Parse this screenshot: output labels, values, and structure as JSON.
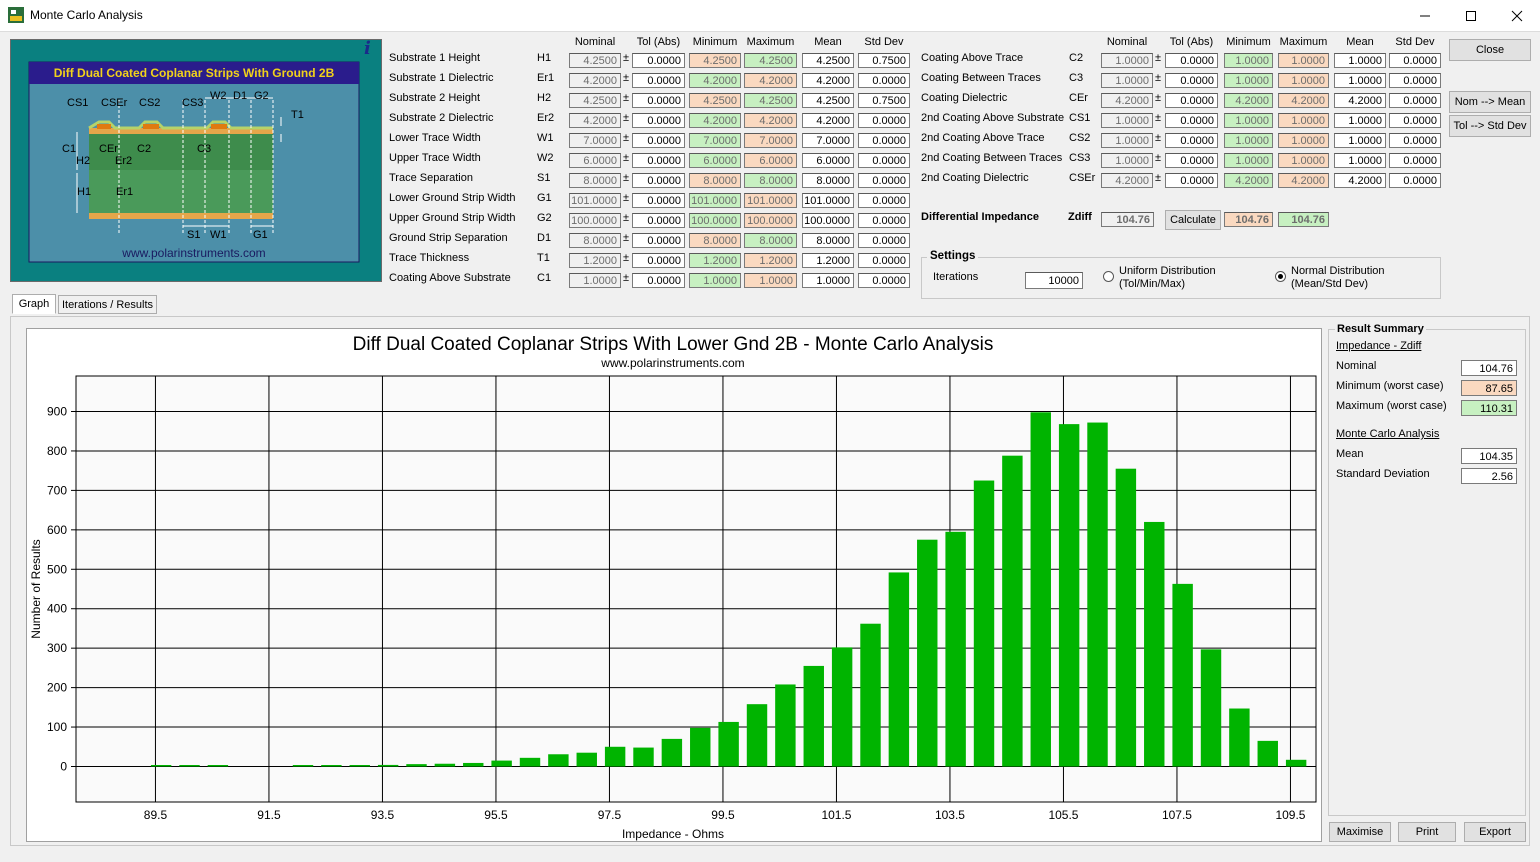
{
  "window": {
    "title": "Monte Carlo Analysis"
  },
  "diagram": {
    "title": "Diff Dual Coated Coplanar Strips With Ground 2B",
    "url": "www.polarinstruments.com",
    "labels": [
      "CS1",
      "CSEr",
      "CS2",
      "CS3",
      "W2",
      "D1",
      "G2",
      "T1",
      "C1",
      "CEr",
      "C2",
      "C3",
      "H2",
      "Er2",
      "H1",
      "Er1",
      "S1",
      "W1",
      "G1"
    ]
  },
  "columns": [
    "Nominal",
    "Tol (Abs)",
    "Minimum",
    "Maximum",
    "Mean",
    "Std Dev"
  ],
  "left_params": [
    {
      "label": "Substrate 1 Height",
      "sym": "H1",
      "nom": "4.2500",
      "tol": "0.0000",
      "min": "4.2500",
      "max": "4.2500",
      "mean": "4.2500",
      "std": "0.7500",
      "minc": "org",
      "maxc": "grn"
    },
    {
      "label": "Substrate 1 Dielectric",
      "sym": "Er1",
      "nom": "4.2000",
      "tol": "0.0000",
      "min": "4.2000",
      "max": "4.2000",
      "mean": "4.2000",
      "std": "0.0000",
      "minc": "grn",
      "maxc": "org"
    },
    {
      "label": "Substrate 2 Height",
      "sym": "H2",
      "nom": "4.2500",
      "tol": "0.0000",
      "min": "4.2500",
      "max": "4.2500",
      "mean": "4.2500",
      "std": "0.7500",
      "minc": "org",
      "maxc": "grn"
    },
    {
      "label": "Substrate 2 Dielectric",
      "sym": "Er2",
      "nom": "4.2000",
      "tol": "0.0000",
      "min": "4.2000",
      "max": "4.2000",
      "mean": "4.2000",
      "std": "0.0000",
      "minc": "grn",
      "maxc": "org"
    },
    {
      "label": "Lower Trace Width",
      "sym": "W1",
      "nom": "7.0000",
      "tol": "0.0000",
      "min": "7.0000",
      "max": "7.0000",
      "mean": "7.0000",
      "std": "0.0000",
      "minc": "grn",
      "maxc": "org"
    },
    {
      "label": "Upper Trace Width",
      "sym": "W2",
      "nom": "6.0000",
      "tol": "0.0000",
      "min": "6.0000",
      "max": "6.0000",
      "mean": "6.0000",
      "std": "0.0000",
      "minc": "grn",
      "maxc": "org"
    },
    {
      "label": "Trace Separation",
      "sym": "S1",
      "nom": "8.0000",
      "tol": "0.0000",
      "min": "8.0000",
      "max": "8.0000",
      "mean": "8.0000",
      "std": "0.0000",
      "minc": "org",
      "maxc": "grn"
    },
    {
      "label": "Lower Ground Strip Width",
      "sym": "G1",
      "nom": "101.0000",
      "tol": "0.0000",
      "min": "101.0000",
      "max": "101.0000",
      "mean": "101.0000",
      "std": "0.0000",
      "minc": "grn",
      "maxc": "org"
    },
    {
      "label": "Upper Ground Strip Width",
      "sym": "G2",
      "nom": "100.0000",
      "tol": "0.0000",
      "min": "100.0000",
      "max": "100.0000",
      "mean": "100.0000",
      "std": "0.0000",
      "minc": "grn",
      "maxc": "org"
    },
    {
      "label": "Ground Strip Separation",
      "sym": "D1",
      "nom": "8.0000",
      "tol": "0.0000",
      "min": "8.0000",
      "max": "8.0000",
      "mean": "8.0000",
      "std": "0.0000",
      "minc": "org",
      "maxc": "grn"
    },
    {
      "label": "Trace Thickness",
      "sym": "T1",
      "nom": "1.2000",
      "tol": "0.0000",
      "min": "1.2000",
      "max": "1.2000",
      "mean": "1.2000",
      "std": "0.0000",
      "minc": "grn",
      "maxc": "org"
    },
    {
      "label": "Coating Above Substrate",
      "sym": "C1",
      "nom": "1.0000",
      "tol": "0.0000",
      "min": "1.0000",
      "max": "1.0000",
      "mean": "1.0000",
      "std": "0.0000",
      "minc": "grn",
      "maxc": "org"
    }
  ],
  "right_params": [
    {
      "label": "Coating Above Trace",
      "sym": "C2",
      "nom": "1.0000",
      "tol": "0.0000",
      "min": "1.0000",
      "max": "1.0000",
      "mean": "1.0000",
      "std": "0.0000",
      "minc": "grn",
      "maxc": "org"
    },
    {
      "label": "Coating Between Traces",
      "sym": "C3",
      "nom": "1.0000",
      "tol": "0.0000",
      "min": "1.0000",
      "max": "1.0000",
      "mean": "1.0000",
      "std": "0.0000",
      "minc": "grn",
      "maxc": "org"
    },
    {
      "label": "Coating Dielectric",
      "sym": "CEr",
      "nom": "4.2000",
      "tol": "0.0000",
      "min": "4.2000",
      "max": "4.2000",
      "mean": "4.2000",
      "std": "0.0000",
      "minc": "grn",
      "maxc": "org"
    },
    {
      "label": "2nd Coating Above Substrate",
      "sym": "CS1",
      "nom": "1.0000",
      "tol": "0.0000",
      "min": "1.0000",
      "max": "1.0000",
      "mean": "1.0000",
      "std": "0.0000",
      "minc": "grn",
      "maxc": "org"
    },
    {
      "label": "2nd Coating Above Trace",
      "sym": "CS2",
      "nom": "1.0000",
      "tol": "0.0000",
      "min": "1.0000",
      "max": "1.0000",
      "mean": "1.0000",
      "std": "0.0000",
      "minc": "grn",
      "maxc": "org"
    },
    {
      "label": "2nd Coating Between Traces",
      "sym": "CS3",
      "nom": "1.0000",
      "tol": "0.0000",
      "min": "1.0000",
      "max": "1.0000",
      "mean": "1.0000",
      "std": "0.0000",
      "minc": "grn",
      "maxc": "org"
    },
    {
      "label": "2nd Coating Dielectric",
      "sym": "CSEr",
      "nom": "4.2000",
      "tol": "0.0000",
      "min": "4.2000",
      "max": "4.2000",
      "mean": "4.2000",
      "std": "0.0000",
      "minc": "grn",
      "maxc": "org"
    }
  ],
  "impedance": {
    "label": "Differential Impedance",
    "sym": "Zdiff",
    "value": "104.76",
    "calc_label": "Calculate",
    "min": "104.76",
    "max": "104.76"
  },
  "buttons": {
    "close": "Close",
    "nom_mean": "Nom --> Mean",
    "tol_std": "Tol --> Std Dev",
    "maximise": "Maximise",
    "print": "Print",
    "export": "Export"
  },
  "settings": {
    "title": "Settings",
    "iterations_label": "Iterations",
    "iterations": "10000",
    "uniform_l1": "Uniform Distribution",
    "uniform_l2": "(Tol/Min/Max)",
    "normal_l1": "Normal Distribution",
    "normal_l2": "(Mean/Std Dev)",
    "selected": "normal"
  },
  "tabs": [
    "Graph",
    "Iterations / Results"
  ],
  "summary": {
    "title": "Result Summary",
    "section1": "Impedance - Zdiff",
    "nominal_label": "Nominal",
    "nominal": "104.76",
    "min_label": "Minimum (worst case)",
    "min": "87.65",
    "max_label": "Maximum (worst case)",
    "max": "110.31",
    "section2": "Monte Carlo Analysis",
    "mean_label": "Mean",
    "mean": "104.35",
    "std_label": "Standard Deviation",
    "std": "2.56"
  },
  "colors": {
    "bar": "#00b400",
    "min_box": "#fad9c0",
    "max_box": "#c7f0c1",
    "diagram_bg": "#0a8080",
    "diagram_title_bg": "#2a1c8c",
    "diagram_title_fg": "#f2d21a"
  },
  "chart_data": {
    "type": "bar",
    "title": "Diff Dual Coated Coplanar Strips With Lower Gnd 2B - Monte Carlo Analysis",
    "subtitle": "www.polarinstruments.com",
    "xlabel": "Impedance - Ohms",
    "ylabel": "Number of Results",
    "xlim": [
      88.1,
      109.95
    ],
    "ylim": [
      -90,
      990
    ],
    "xticks": [
      89.5,
      91.5,
      93.5,
      95.5,
      97.5,
      99.5,
      101.5,
      103.5,
      105.5,
      107.5,
      109.5
    ],
    "xtick_labels": [
      "89.5",
      "91.5",
      "93.5",
      "95.5",
      "97.5",
      "99.5",
      "101.5",
      "103.5",
      "105.5",
      "107.5",
      "109.5"
    ],
    "yticks": [
      0,
      100,
      200,
      300,
      400,
      500,
      600,
      700,
      800,
      900
    ],
    "grid": true,
    "x": [
      89.6,
      90.1,
      90.6,
      92.1,
      92.6,
      93.1,
      93.6,
      94.1,
      94.6,
      95.1,
      95.6,
      96.1,
      96.6,
      97.1,
      97.6,
      98.1,
      98.6,
      99.1,
      99.6,
      100.1,
      100.6,
      101.1,
      101.6,
      102.1,
      102.6,
      103.1,
      103.6,
      104.1,
      104.6,
      105.1,
      105.6,
      106.1,
      106.6,
      107.1,
      107.6,
      108.1,
      108.6,
      109.1,
      109.6
    ],
    "values": [
      2,
      1,
      1,
      3,
      3,
      2,
      4,
      6,
      7,
      9,
      15,
      22,
      31,
      35,
      50,
      48,
      70,
      98,
      113,
      158,
      208,
      255,
      302,
      362,
      492,
      575,
      595,
      725,
      788,
      898,
      868,
      872,
      755,
      620,
      463,
      297,
      147,
      65,
      17,
      4
    ]
  }
}
